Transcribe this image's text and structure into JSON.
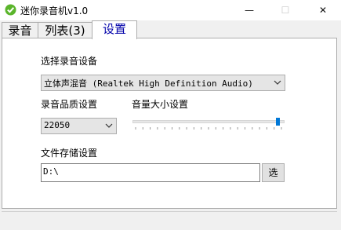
{
  "window": {
    "title": "迷你录音机v1.0",
    "min_glyph": "—",
    "max_glyph": "☐",
    "close_glyph": "✕"
  },
  "tabs": [
    {
      "label": "录音",
      "active": false
    },
    {
      "label": "列表(3)",
      "active": false
    },
    {
      "label": "设置",
      "active": true
    }
  ],
  "settings": {
    "device_label": "选择录音设备",
    "device_value": "立体声混音 (Realtek High Definition Audio)",
    "quality_label": "录音品质设置",
    "quality_value": "22050",
    "volume_label": "音量大小设置",
    "volume_level_percent": 97,
    "storage_label": "文件存储设置",
    "storage_path": "D:\\",
    "browse_button": "选"
  },
  "colors": {
    "accent": "#0078d7",
    "active_tab_text": "#0000aa",
    "icon": "#5bb52c"
  }
}
